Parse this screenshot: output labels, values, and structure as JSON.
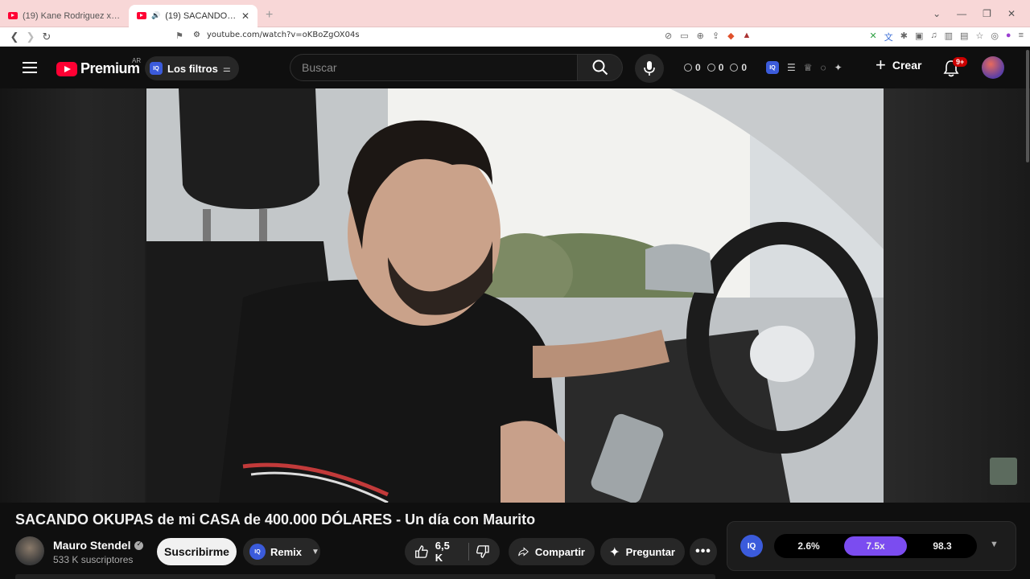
{
  "browser": {
    "tabs": [
      {
        "title": "(19) Kane Rodriguez x Juan Freer - P",
        "active": false
      },
      {
        "title": "(19) SACANDO OKUPAS de mi CASA",
        "active": true
      }
    ],
    "url": "youtube.com/watch?v=oKBoZgOX04s",
    "colors": {
      "tabbar": "#f8d7d7"
    }
  },
  "header": {
    "brand": "Premium",
    "country": "AR",
    "filters_label": "Los filtros",
    "search_placeholder": "Buscar",
    "counters": [
      "0",
      "0",
      "0"
    ],
    "create_label": "Crear",
    "notif_badge": "9+",
    "iq_badge": "IQ"
  },
  "video": {
    "title": "SACANDO OKUPAS de mi CASA de 400.000 DÓLARES - Un día con Maurito"
  },
  "channel": {
    "name": "Mauro Stendel",
    "subscribers": "533 K suscriptores",
    "subscribe_label": "Suscribirme",
    "remix_label": "Remix"
  },
  "actions": {
    "likes": "6,5 K",
    "share_label": "Compartir",
    "ask_label": "Preguntar"
  },
  "iq_panel": {
    "logo": "IQ",
    "stats": [
      "2.6%",
      "7.5x",
      "98.3"
    ],
    "active_stat": 1,
    "accent": "#7b4cf0"
  }
}
